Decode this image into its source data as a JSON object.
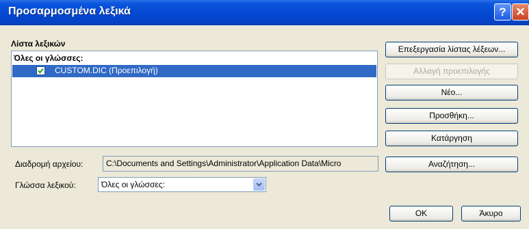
{
  "window": {
    "title": "Προσαρμοσμένα λεξικά",
    "help_glyph": "?",
    "close_glyph": "✕"
  },
  "dictionary_list": {
    "label": "Λίστα λεξικών",
    "group_header": "Όλες οι γλώσσες:",
    "items": [
      {
        "label": "CUSTOM.DIC (Προεπιλογή)",
        "checked": true,
        "selected": true
      }
    ]
  },
  "buttons": {
    "edit_word_list": "Επεξεργασία λίστας λέξεων...",
    "change_default": "Αλλαγή προεπιλογής",
    "new": "Νέο...",
    "add": "Προσθήκη...",
    "remove": "Κατάργηση",
    "browse": "Αναζήτηση...",
    "ok": "OK",
    "cancel": "Άκυρο"
  },
  "file_path": {
    "label": "Διαδρομή αρχείου:",
    "value": "C:\\Documents and Settings\\Administrator\\Application Data\\Micro"
  },
  "dictionary_language": {
    "label": "Γλώσσα λεξικού:",
    "selected": "Όλες οι γλώσσες:"
  },
  "colors": {
    "titlebar": "#0447d0",
    "selection": "#316ac5",
    "dialog_bg": "#ece9d8",
    "checkmark": "#21a121"
  }
}
